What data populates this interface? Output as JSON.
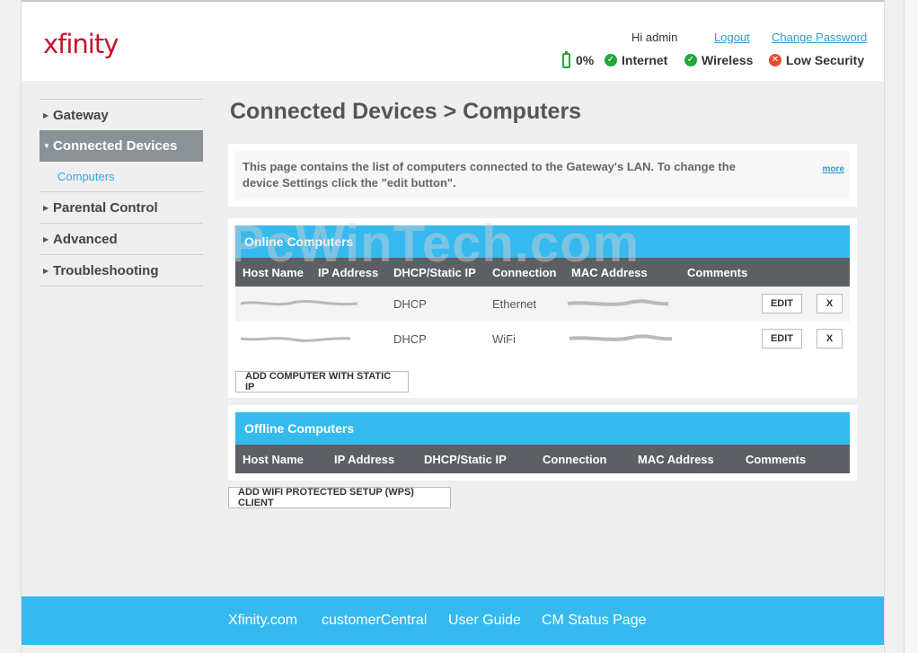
{
  "header": {
    "logo": "xfinity",
    "greeting": "Hi admin",
    "logout": "Logout",
    "change_password": "Change Password",
    "battery": "0%",
    "internet": "Internet",
    "wireless": "Wireless",
    "security": "Low Security"
  },
  "nav": {
    "gateway": "Gateway",
    "connected_devices": "Connected Devices",
    "computers": "Computers",
    "parental_control": "Parental Control",
    "advanced": "Advanced",
    "troubleshooting": "Troubleshooting"
  },
  "main": {
    "title": "Connected Devices > Computers",
    "info": "This page contains the list of computers connected to the Gateway's LAN. To change the device Settings click the \"edit button\".",
    "more": "more"
  },
  "online": {
    "title": "Online Computers",
    "columns": [
      "Host Name",
      "IP Address",
      "DHCP/Static IP",
      "Connection",
      "MAC Address",
      "Comments"
    ],
    "rows": [
      {
        "dhcp": "DHCP",
        "connection": "Ethernet",
        "edit": "EDIT",
        "remove": "X"
      },
      {
        "dhcp": "DHCP",
        "connection": "WiFi",
        "edit": "EDIT",
        "remove": "X"
      }
    ],
    "add_button": "ADD COMPUTER WITH STATIC IP"
  },
  "offline": {
    "title": "Offline Computers",
    "columns": [
      "Host Name",
      "IP Address",
      "DHCP/Static IP",
      "Connection",
      "MAC Address",
      "Comments"
    ]
  },
  "wps_button": "ADD WIFI PROTECTED SETUP (WPS) CLIENT",
  "footer": {
    "links": [
      "Xfinity.com",
      "customerCentral",
      "User Guide",
      "CM Status Page"
    ]
  },
  "watermark": "PcWinTech.com",
  "colors": {
    "accent": "#36b9ee",
    "brand": "#c8102e",
    "ok": "#22a73d",
    "alert": "#e8492a"
  }
}
